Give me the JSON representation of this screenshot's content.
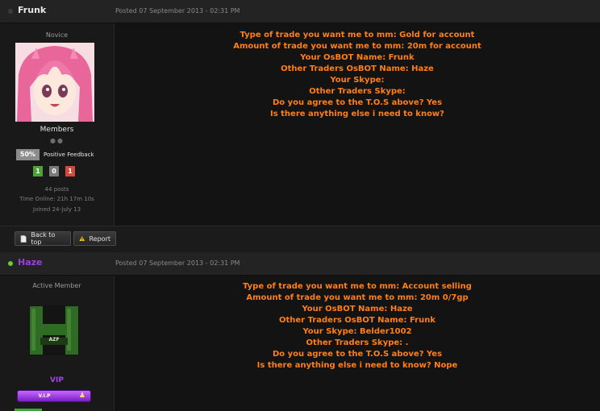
{
  "post1": {
    "author": "Frunk",
    "author_color": "#e8e8e8",
    "status_icon": "offline-dot-icon",
    "posted": "Posted 07 September 2013 - 02:31 PM",
    "rank": "Novice",
    "avatar": "anime-girl-avatar",
    "group": "Members",
    "feedback_percent": "50%",
    "feedback_label": "Positive Feedback",
    "rep": [
      "1",
      "0",
      "1"
    ],
    "posts": "44 posts",
    "time_online": "Time Online: 21h 17m 10s",
    "joined": "Joined 24-July 13",
    "lines": [
      "Type of trade you want me to mm: Gold for account",
      "Amount of trade you want me to mm: 20m for account",
      "Your OsBOT Name: Frunk",
      "Other Traders OsBOT Name: Haze",
      "Your Skype:",
      "Other Traders Skype:",
      "Do you agree to the T.O.S above? Yes",
      "Is there anything else i need to know?"
    ]
  },
  "buttons": {
    "back_to_top": "Back to top",
    "report": "Report"
  },
  "post2": {
    "author": "Haze",
    "author_color": "#9a3fe0",
    "status_icon": "online-dot-icon",
    "posted": "Posted 07 September 2013 - 02:31 PM",
    "rank": "Active Member",
    "avatar": "green-h-avatar",
    "avatar_text": "AZF",
    "group": "VIP",
    "vip_badge": "V.I.P",
    "lines": [
      "Type of trade you want me to mm: Account selling",
      "Amount of trade you want me to mm: 20m 0/7gp",
      "Your OsBOT Name: Haze",
      "Other Traders OsBOT Name: Frunk",
      "Your Skype: Belder1002",
      "Other Traders Skype: .",
      "Do you agree to the T.O.S above? Yes",
      "Is there anything else i need to know? Nope"
    ]
  }
}
